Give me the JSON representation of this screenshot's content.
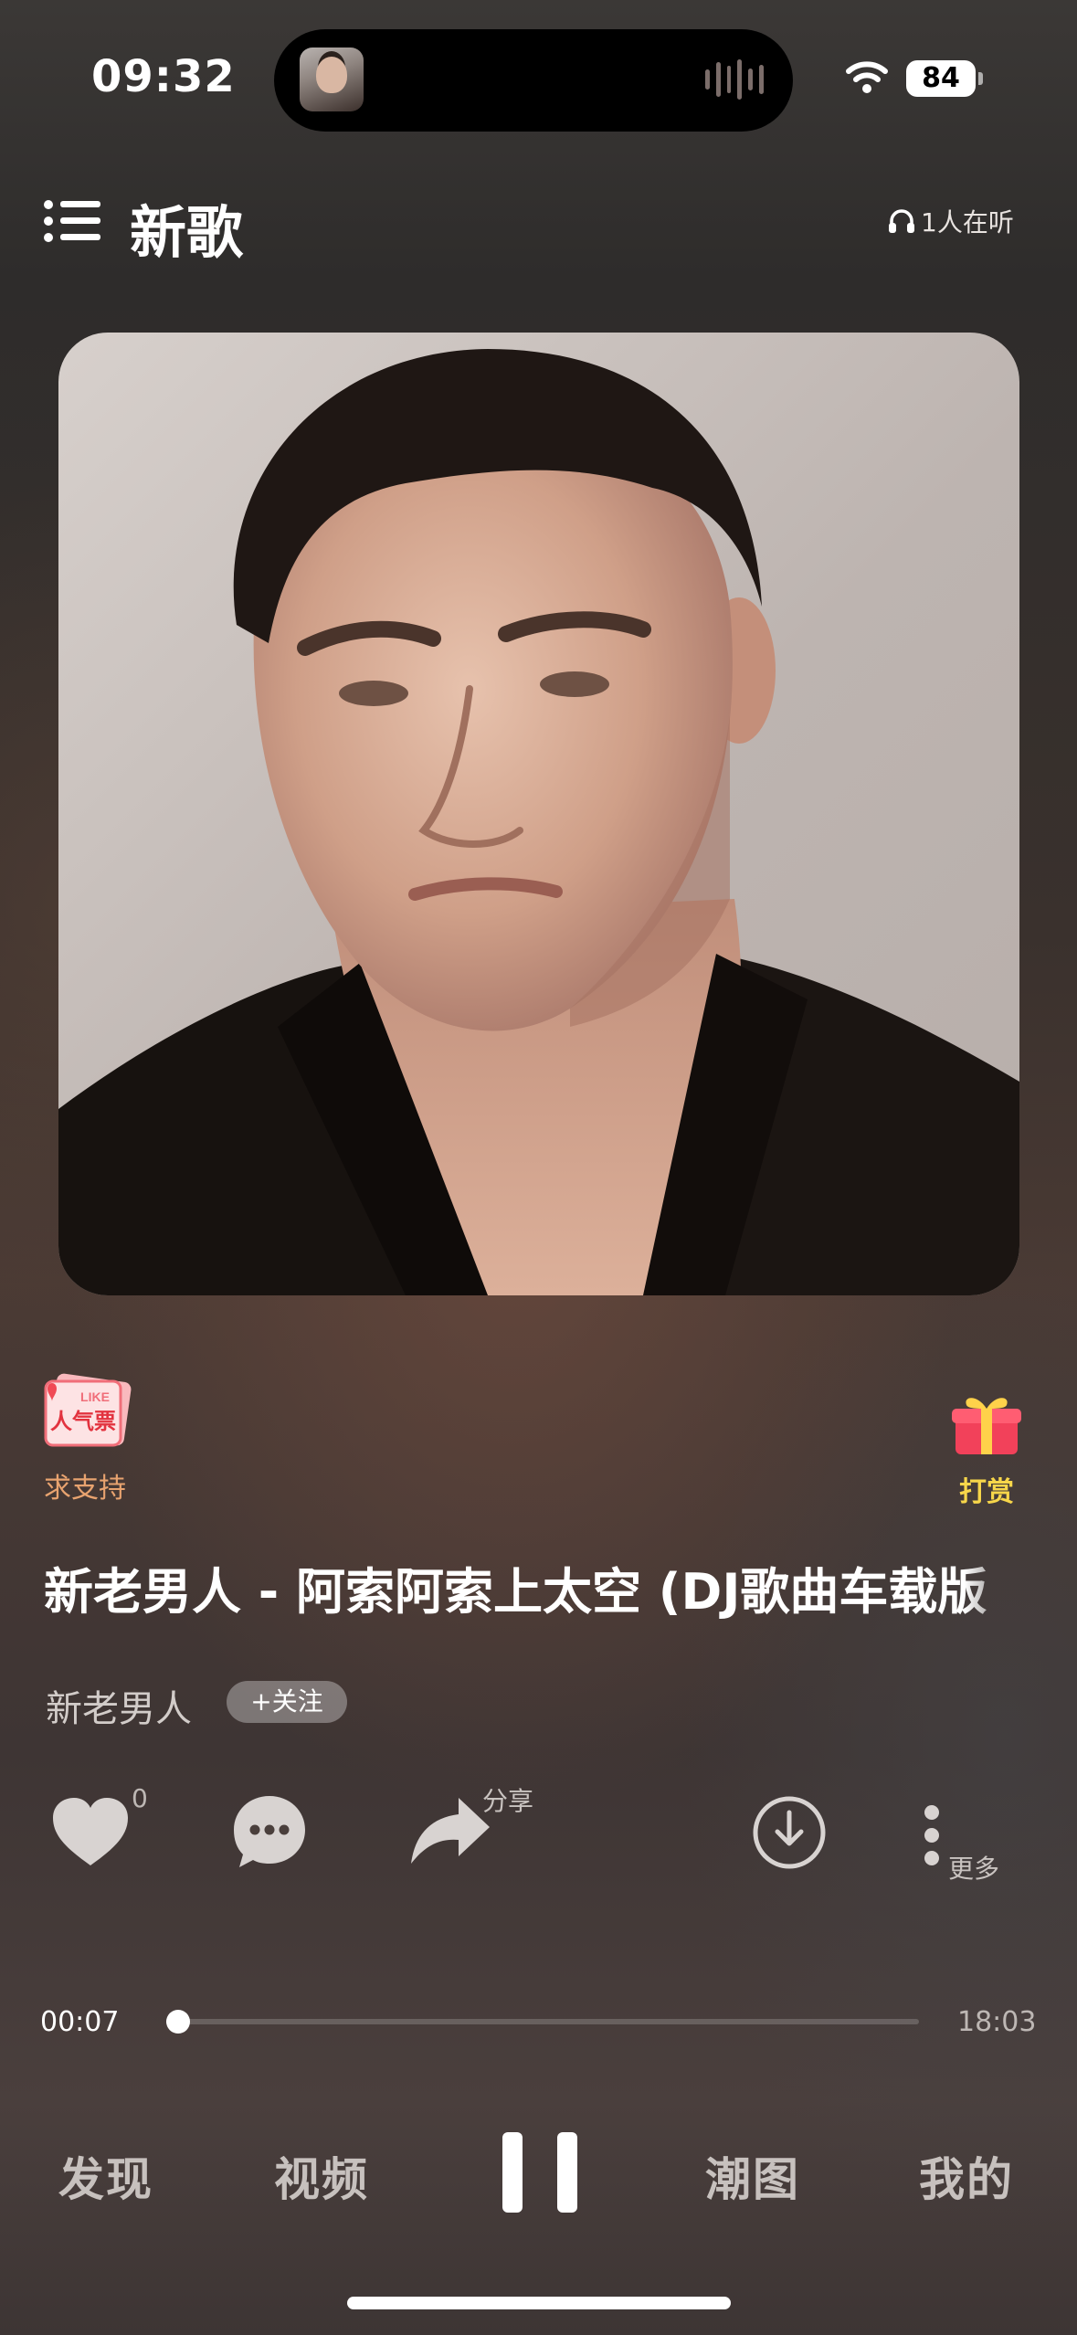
{
  "status_bar": {
    "time": "09:32",
    "battery": "84"
  },
  "header": {
    "title": "新歌",
    "listeners": "1人在听"
  },
  "side_actions": {
    "support_label": "求支持",
    "support_badge": "人气票",
    "support_badge_en": "LIKE",
    "gift_label": "打赏"
  },
  "song": {
    "title": "新老男人 - 阿索阿索上太空 (DJ歌曲车载版",
    "artist": "新老男人",
    "follow_label": "+关注"
  },
  "actions": {
    "like_count": "0",
    "share_label": "分享",
    "more_label": "更多"
  },
  "progress": {
    "current": "00:07",
    "total": "18:03",
    "fraction": 0.0065
  },
  "nav": {
    "discover": "发现",
    "video": "视频",
    "trend": "潮图",
    "mine": "我的"
  },
  "icons": [
    "menu-icon",
    "headphones-icon",
    "popularity-ticket-icon",
    "gift-icon",
    "heart-icon",
    "comment-icon",
    "share-icon",
    "download-icon",
    "more-dots-icon",
    "pause-icon",
    "wifi-icon"
  ],
  "colors": {
    "support": "#e8a36f",
    "gift": "#f7d64a"
  }
}
